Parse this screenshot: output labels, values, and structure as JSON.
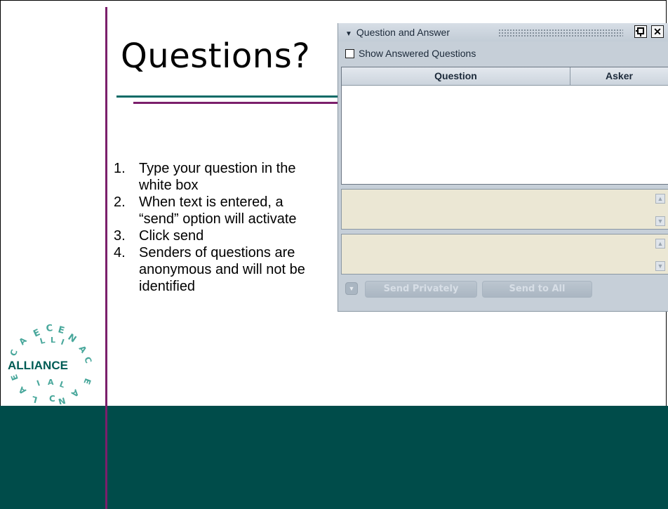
{
  "slide": {
    "title": "Questions?",
    "steps": [
      {
        "num": "1.",
        "text": "Type your question in the white box"
      },
      {
        "num": "2.",
        "text": "When text is entered, a “send” option will activate"
      },
      {
        "num": "3.",
        "text": "Click send"
      },
      {
        "num": "4.",
        "text": "Senders of questions are anonymous and will not be identified"
      }
    ],
    "logo_text": "ALLIANCE"
  },
  "qa_panel": {
    "title": "Question and Answer",
    "collapse_icon": "triangle-down-icon",
    "pin_icon": "pin-icon",
    "close_icon": "close-icon",
    "show_answered_label": "Show Answered Questions",
    "show_answered_checked": false,
    "columns": [
      "Question",
      "Asker"
    ],
    "rows": [],
    "buttons": {
      "send_privately": "Send Privately",
      "send_to_all": "Send to All"
    }
  },
  "colors": {
    "accent_purple": "#7b1f6b",
    "accent_teal": "#0a6b66",
    "bottom_band": "#004c4a",
    "input_bg": "#ebe7d4"
  }
}
